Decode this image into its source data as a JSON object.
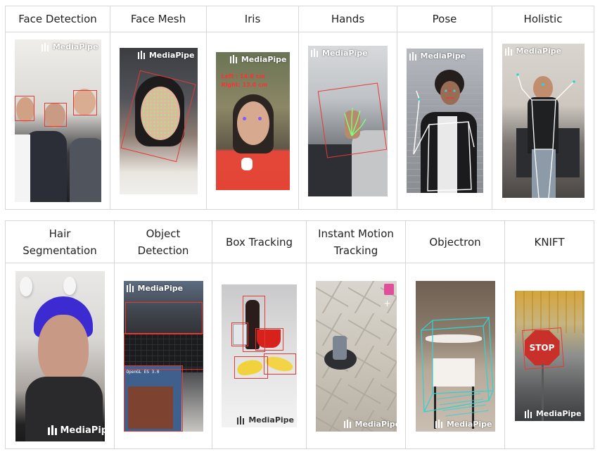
{
  "row1": [
    {
      "title": "Face Detection"
    },
    {
      "title": "Face Mesh"
    },
    {
      "title": "Iris"
    },
    {
      "title": "Hands"
    },
    {
      "title": "Pose"
    },
    {
      "title": "Holistic"
    }
  ],
  "row2": [
    {
      "title_line1": "Hair",
      "title_line2": "Segmentation"
    },
    {
      "title_line1": "Object",
      "title_line2": "Detection"
    },
    {
      "title_line1": "Box Tracking",
      "title_line2": ""
    },
    {
      "title_line1": "Instant Motion",
      "title_line2": "Tracking"
    },
    {
      "title_line1": "Objectron",
      "title_line2": ""
    },
    {
      "title_line1": "KNIFT",
      "title_line2": ""
    }
  ],
  "brand": "MediaPipe",
  "overlays": {
    "iris_left": "Left : 14.6 cm",
    "iris_right": "Right: 13.0 cm",
    "stop_sign": "STOP"
  },
  "colors": {
    "detection_red": "#e53935",
    "mesh_green": "#7dff7d",
    "pose_white": "#ffffff",
    "objectron_cyan": "#35d0d0",
    "border": "#d6d6d6"
  }
}
